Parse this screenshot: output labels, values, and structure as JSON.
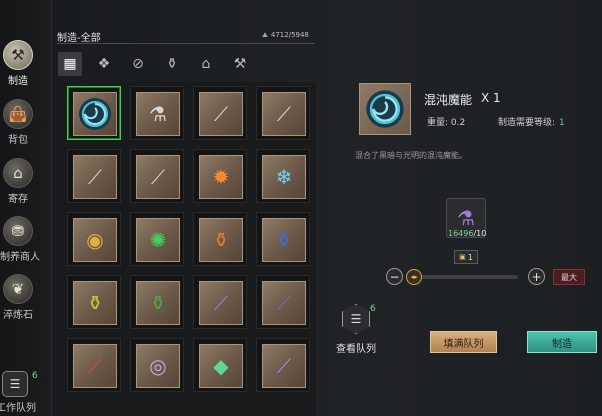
{
  "sidebar": {
    "items": [
      {
        "label": "制造",
        "icon": "hammer-icon",
        "active": true
      },
      {
        "label": "背包",
        "icon": "bag-icon",
        "active": false
      },
      {
        "label": "寄存",
        "icon": "storage-icon",
        "active": false
      },
      {
        "label": "制养商人",
        "icon": "merchant-icon",
        "active": false
      },
      {
        "label": "淬炼石",
        "icon": "stone-icon",
        "active": false
      }
    ],
    "queue": {
      "label": "工作队列",
      "badge": "6",
      "icon": "queue-icon"
    }
  },
  "category": {
    "title": "制造-全部",
    "weight": "4712/5948",
    "weight_icon": "weight-icon"
  },
  "filters": [
    {
      "icon": "all-grid-icon",
      "active": true
    },
    {
      "icon": "material-icon",
      "active": false
    },
    {
      "icon": "disabled-filter-icon",
      "active": false
    },
    {
      "icon": "potion-icon",
      "active": false
    },
    {
      "icon": "building-icon",
      "active": false
    },
    {
      "icon": "tool-icon",
      "active": false
    }
  ],
  "items": [
    {
      "name": "混沌魔能",
      "icon": "chaos-orb-icon",
      "selected": true
    },
    {
      "name": "purple potion",
      "icon": "purple-potion-icon"
    },
    {
      "name": "golden staff",
      "icon": "golden-staff-icon"
    },
    {
      "name": "jade staff",
      "icon": "jade-staff-icon"
    },
    {
      "name": "bone staff",
      "icon": "bone-staff-icon"
    },
    {
      "name": "wooden staff",
      "icon": "wooden-staff-icon"
    },
    {
      "name": "fire essence",
      "icon": "fire-essence-icon"
    },
    {
      "name": "ice essence",
      "icon": "ice-essence-icon"
    },
    {
      "name": "gold amulet",
      "icon": "gold-amulet-icon"
    },
    {
      "name": "green rune",
      "icon": "green-rune-icon"
    },
    {
      "name": "orange potion",
      "icon": "orange-potion-icon"
    },
    {
      "name": "blue potion",
      "icon": "blue-potion-icon"
    },
    {
      "name": "yellow potion",
      "icon": "yellow-potion-icon"
    },
    {
      "name": "green potion",
      "icon": "green-potion-icon"
    },
    {
      "name": "violet wand",
      "icon": "violet-wand-icon"
    },
    {
      "name": "iron wand",
      "icon": "iron-wand-icon"
    },
    {
      "name": "red wand",
      "icon": "red-wand-icon"
    },
    {
      "name": "crystal orb",
      "icon": "crystal-orb-icon"
    },
    {
      "name": "green crystal",
      "icon": "green-crystal-icon"
    },
    {
      "name": "violet scepter",
      "icon": "violet-scepter-icon"
    }
  ],
  "detail": {
    "name": "混沌魔能",
    "quantity": "X 1",
    "weight_label": "重量: 0.2",
    "level_label": "制造需要等级:",
    "level_value": "1",
    "description": "混合了黑暗与光明的混沌魔能。",
    "icon": "chaos-orb-icon",
    "material": {
      "have": "16496",
      "need": "/10",
      "icon": "purple-potion-icon"
    }
  },
  "quantity_control": {
    "value": "1",
    "bag_icon": "bag-small-icon",
    "fill_fraction": 0.02,
    "minus_icon": "minus-icon",
    "plus_icon": "plus-icon",
    "max_label": "最大"
  },
  "actions": {
    "view_queue_label": "查看队列",
    "view_queue_badge": "6",
    "fill_queue_label": "填满队列",
    "craft_label": "制造"
  },
  "colors": {
    "selected_border": "#39d248",
    "craft_button": "#3aa897",
    "fill_button": "#c89868",
    "level_value": "#5ec5c9",
    "material_have": "#7dd8a6"
  }
}
